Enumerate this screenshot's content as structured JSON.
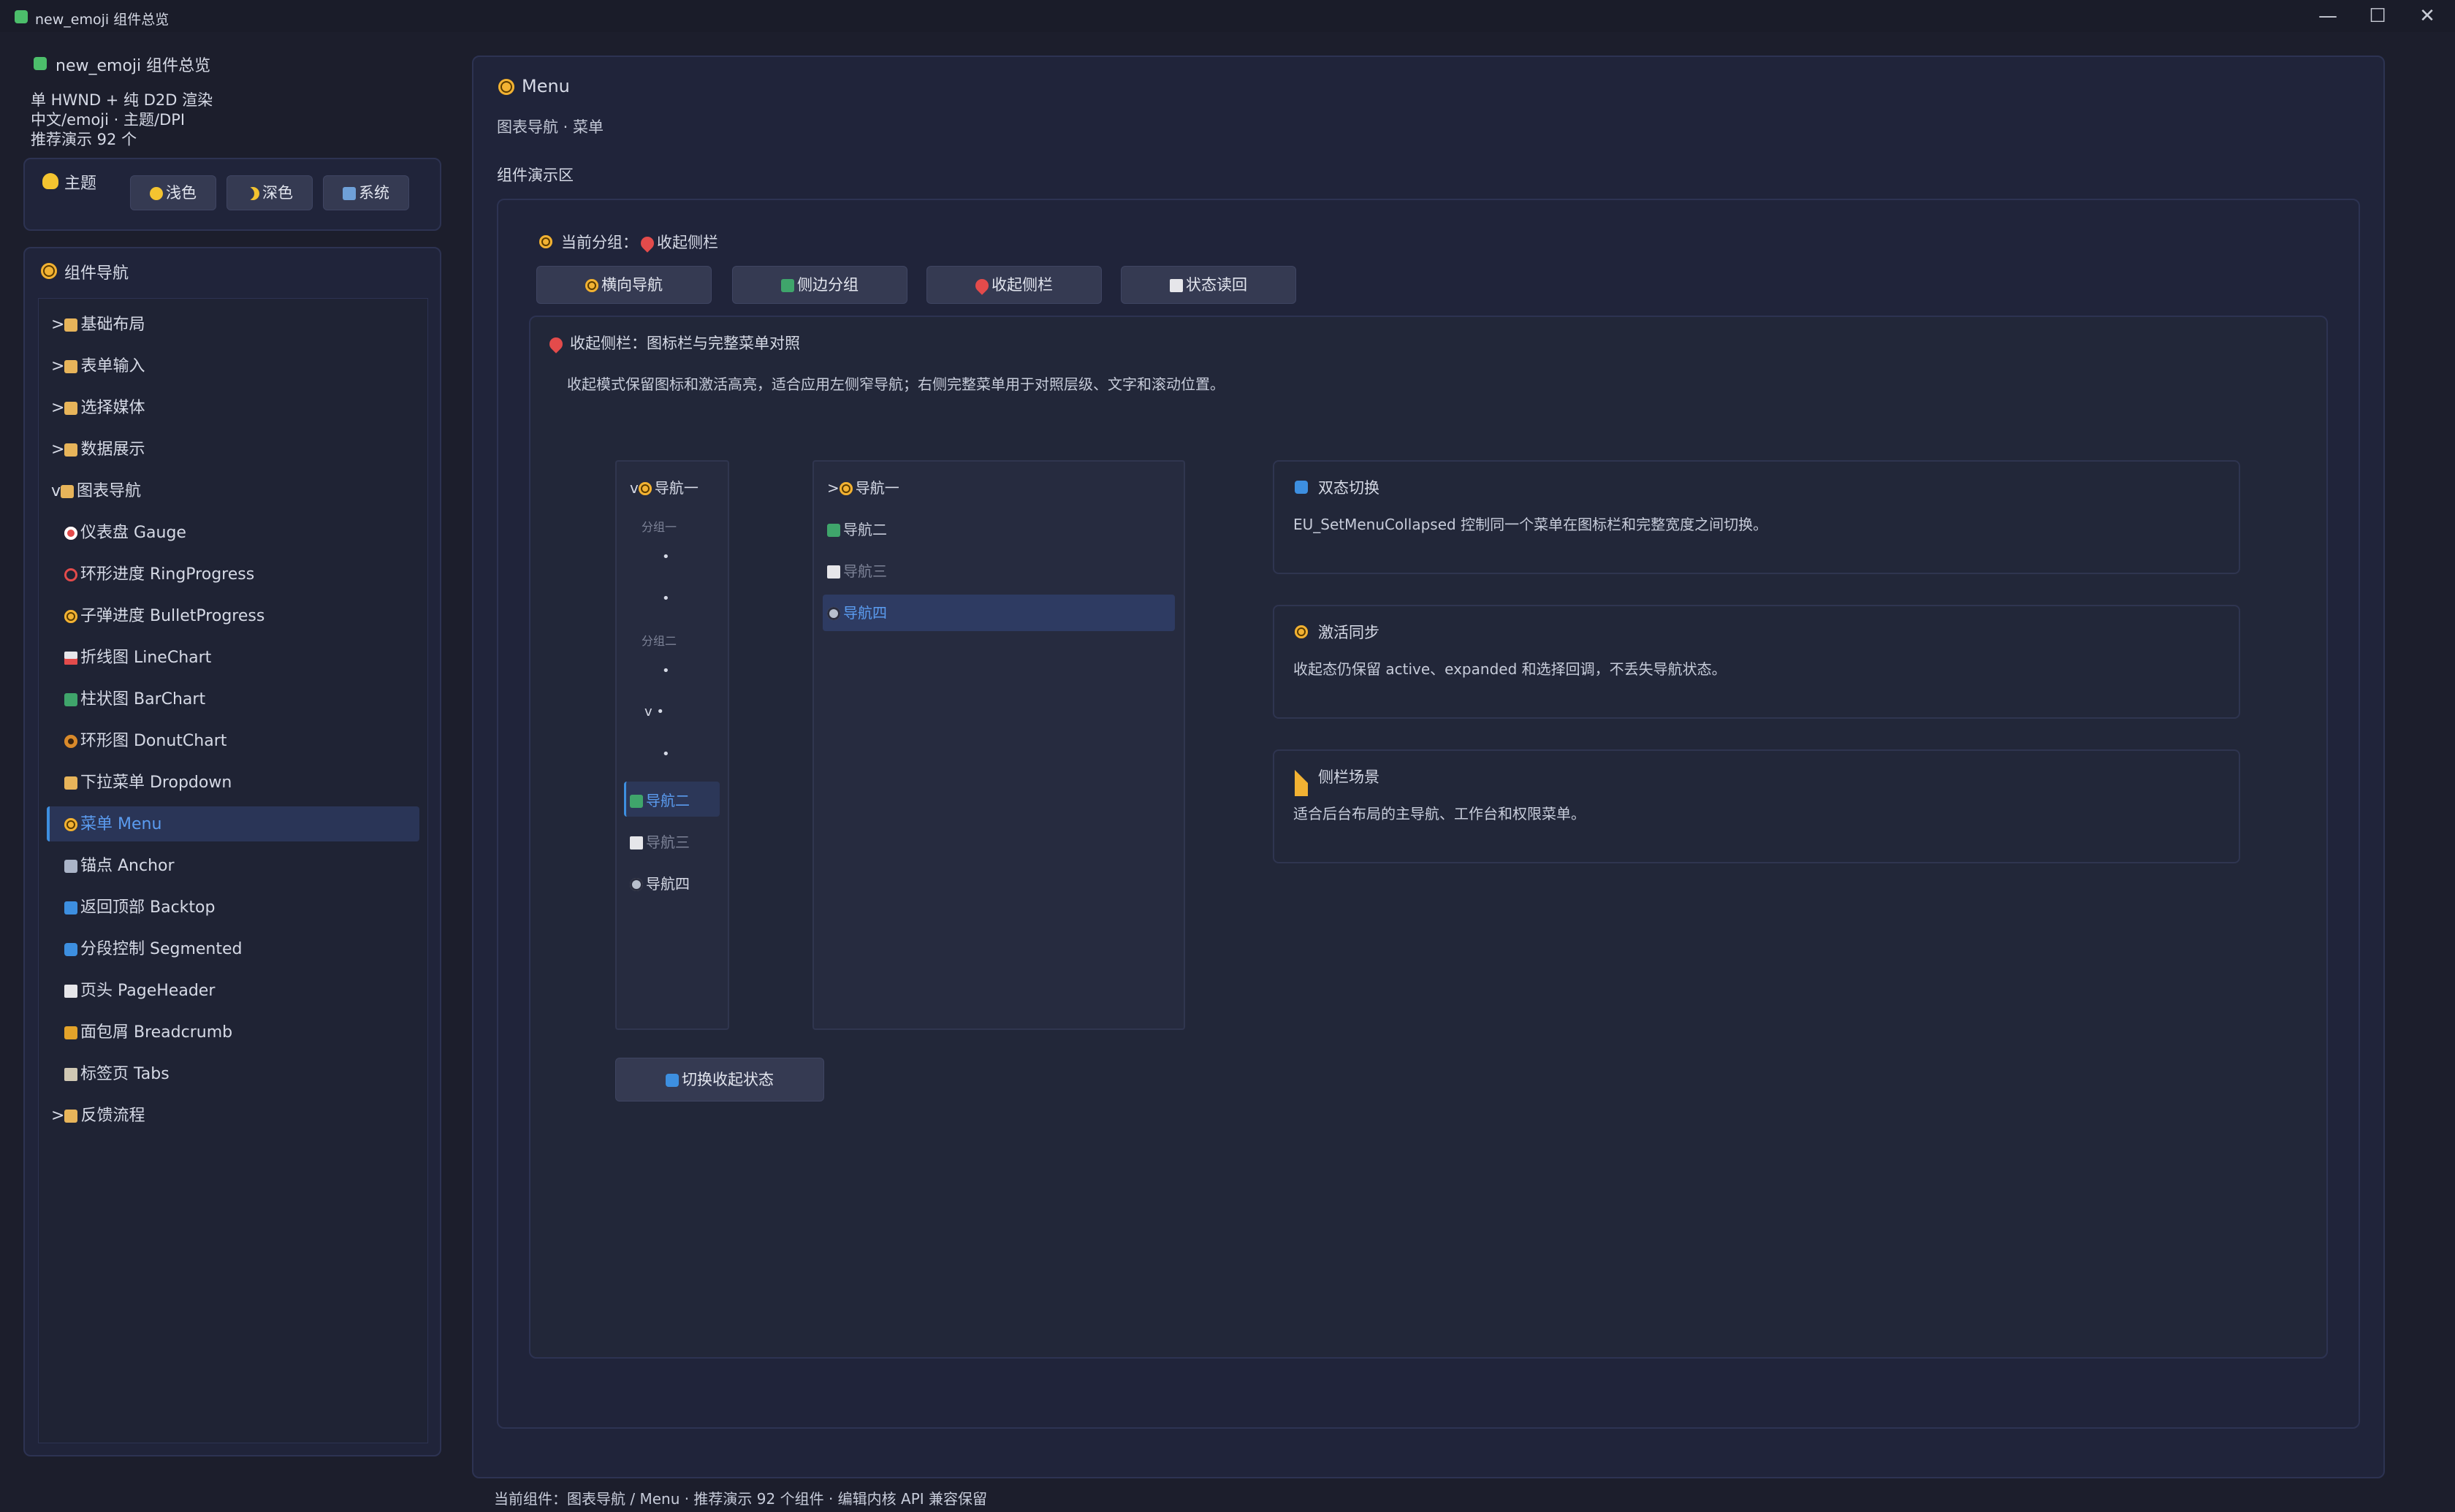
{
  "window": {
    "title": "new_emoji 组件总览",
    "controls": [
      "—",
      "☐",
      "✕"
    ]
  },
  "sidebar": {
    "app_title": "new_emoji 组件总览",
    "info": [
      "单 HWND + 纯 D2D 渲染",
      "中文/emoji · 主题/DPI",
      "推荐演示 92 个"
    ],
    "theme": {
      "label": "主题",
      "buttons": [
        "浅色",
        "深色",
        "系统"
      ]
    },
    "nav": {
      "title": "组件导航",
      "groups": [
        {
          "toggle": ">",
          "label": "基础布局"
        },
        {
          "toggle": ">",
          "label": "表单输入"
        },
        {
          "toggle": ">",
          "label": "选择媒体"
        },
        {
          "toggle": ">",
          "label": "数据展示"
        },
        {
          "toggle": "v",
          "label": "图表导航"
        }
      ],
      "items": [
        {
          "label": "仪表盘 Gauge",
          "icon": "target-icon"
        },
        {
          "label": "环形进度 RingProgress",
          "icon": "ring-icon"
        },
        {
          "label": "子弹进度 BulletProgress",
          "icon": "clock-icon"
        },
        {
          "label": "折线图 LineChart",
          "icon": "line-chart-icon"
        },
        {
          "label": "柱状图 BarChart",
          "icon": "bar-chart-icon"
        },
        {
          "label": "环形图 DonutChart",
          "icon": "donut-icon"
        },
        {
          "label": "下拉菜单 Dropdown",
          "icon": "folder-icon"
        },
        {
          "label": "菜单 Menu",
          "icon": "clock-icon",
          "selected": true
        },
        {
          "label": "锚点 Anchor",
          "icon": "anchor-icon"
        },
        {
          "label": "返回顶部 Backtop",
          "icon": "up-arrow-icon"
        },
        {
          "label": "分段控制 Segmented",
          "icon": "segmented-icon"
        },
        {
          "label": "页头 PageHeader",
          "icon": "page-icon"
        },
        {
          "label": "面包屑 Breadcrumb",
          "icon": "breadcrumb-icon"
        },
        {
          "label": "标签页 Tabs",
          "icon": "tabs-icon"
        }
      ],
      "last_group": {
        "toggle": ">",
        "label": "反馈流程"
      }
    }
  },
  "main": {
    "title": "Menu",
    "subtitle": "图表导航 · 菜单",
    "demo_area_label": "组件演示区",
    "current_group_prefix": "当前分组：",
    "current_group": "收起侧栏",
    "tabs": [
      "横向导航",
      "侧边分组",
      "收起侧栏",
      "状态读回"
    ],
    "section_title": "收起侧栏：图标栏与完整菜单对照",
    "section_desc": "收起模式保留图标和激活高亮，适合应用左侧窄导航；右侧完整菜单用于对照层级、文字和滚动位置。",
    "collapsed_menu": {
      "first": {
        "toggle": "v",
        "label": "导航一"
      },
      "group1": "分组一",
      "group2": "分组二",
      "sub_toggle": "v",
      "bullet": "•",
      "items": [
        {
          "label": "导航二",
          "active": true
        },
        {
          "label": "导航三",
          "disabled": true
        },
        {
          "label": "导航四"
        }
      ]
    },
    "full_menu": {
      "items": [
        {
          "toggle": ">",
          "label": "导航一"
        },
        {
          "label": "导航二"
        },
        {
          "label": "导航三",
          "disabled": true
        },
        {
          "label": "导航四",
          "selected": true
        }
      ]
    },
    "toggle_button": "切换收起状态",
    "cards": [
      {
        "title": "双态切换",
        "text": "EU_SetMenuCollapsed 控制同一个菜单在图标栏和完整宽度之间切换。"
      },
      {
        "title": "激活同步",
        "text": "收起态仍保留 active、expanded 和选择回调，不丢失导航状态。"
      },
      {
        "title": "侧栏场景",
        "text": "适合后台布局的主导航、工作台和权限菜单。"
      }
    ]
  },
  "status_bar": "当前组件：图表导航 / Menu · 推荐演示 92 个组件 · 编辑内核 API 兼容保留",
  "colors": {
    "background": "#1c1e2c",
    "panel": "#20243a",
    "accent": "#3d8fe0",
    "selected": "#2e3b62"
  }
}
